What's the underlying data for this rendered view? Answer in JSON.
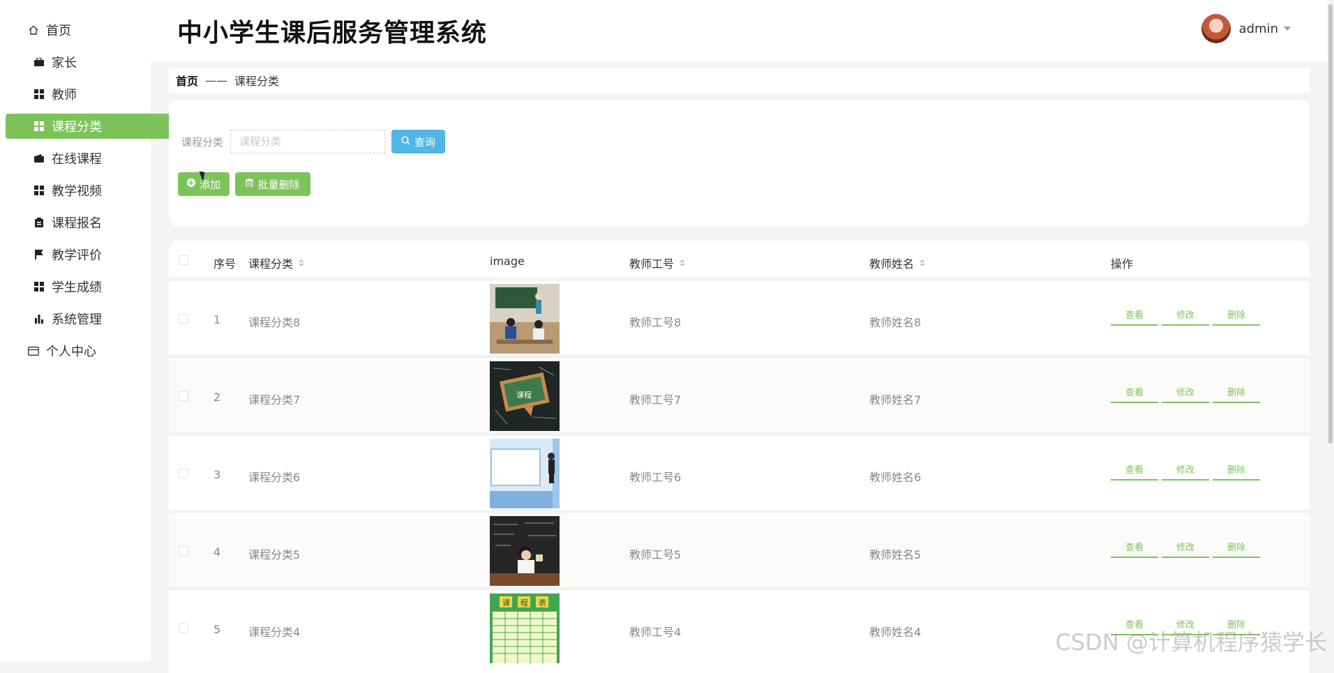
{
  "sidebar": {
    "items": [
      {
        "label": "首页",
        "icon": "home-icon"
      },
      {
        "label": "家长",
        "icon": "briefcase-icon"
      },
      {
        "label": "教师",
        "icon": "grid-icon"
      },
      {
        "label": "课程分类",
        "icon": "grid-icon",
        "active": true
      },
      {
        "label": "在线课程",
        "icon": "wallet-icon"
      },
      {
        "label": "教学视频",
        "icon": "grid-icon"
      },
      {
        "label": "课程报名",
        "icon": "clipboard-icon"
      },
      {
        "label": "教学评价",
        "icon": "flag-icon"
      },
      {
        "label": "学生成绩",
        "icon": "grid-icon"
      },
      {
        "label": "系统管理",
        "icon": "bar-chart-icon"
      },
      {
        "label": "个人中心",
        "icon": "card-icon"
      }
    ]
  },
  "header": {
    "title": "中小学生课后服务管理系统",
    "username": "admin"
  },
  "breadcrumb": {
    "home": "首页",
    "separator": "——",
    "current": "课程分类"
  },
  "search": {
    "label": "课程分类",
    "placeholder": "课程分类",
    "query_label": "查询"
  },
  "actions": {
    "add_label": "添加",
    "batch_delete_label": "批量删除"
  },
  "table": {
    "columns": [
      "序号",
      "课程分类",
      "image",
      "教师工号",
      "教师姓名",
      "操作"
    ],
    "op_labels": {
      "view": "查看",
      "edit": "修改",
      "delete": "删除"
    },
    "rows": [
      {
        "index": "1",
        "category": "课程分类8",
        "teacher_id": "教师工号8",
        "teacher_name": "教师姓名8"
      },
      {
        "index": "2",
        "category": "课程分类7",
        "teacher_id": "教师工号7",
        "teacher_name": "教师姓名7"
      },
      {
        "index": "3",
        "category": "课程分类6",
        "teacher_id": "教师工号6",
        "teacher_name": "教师姓名6"
      },
      {
        "index": "4",
        "category": "课程分类5",
        "teacher_id": "教师工号5",
        "teacher_name": "教师姓名5"
      },
      {
        "index": "5",
        "category": "课程分类4",
        "teacher_id": "教师工号4",
        "teacher_name": "教师姓名4"
      }
    ]
  },
  "watermark": "CSDN @计算机程序猿学长",
  "colors": {
    "accent_green": "#7cc45a",
    "query_blue": "#4fb6e6",
    "background": "#f4f4f5"
  }
}
